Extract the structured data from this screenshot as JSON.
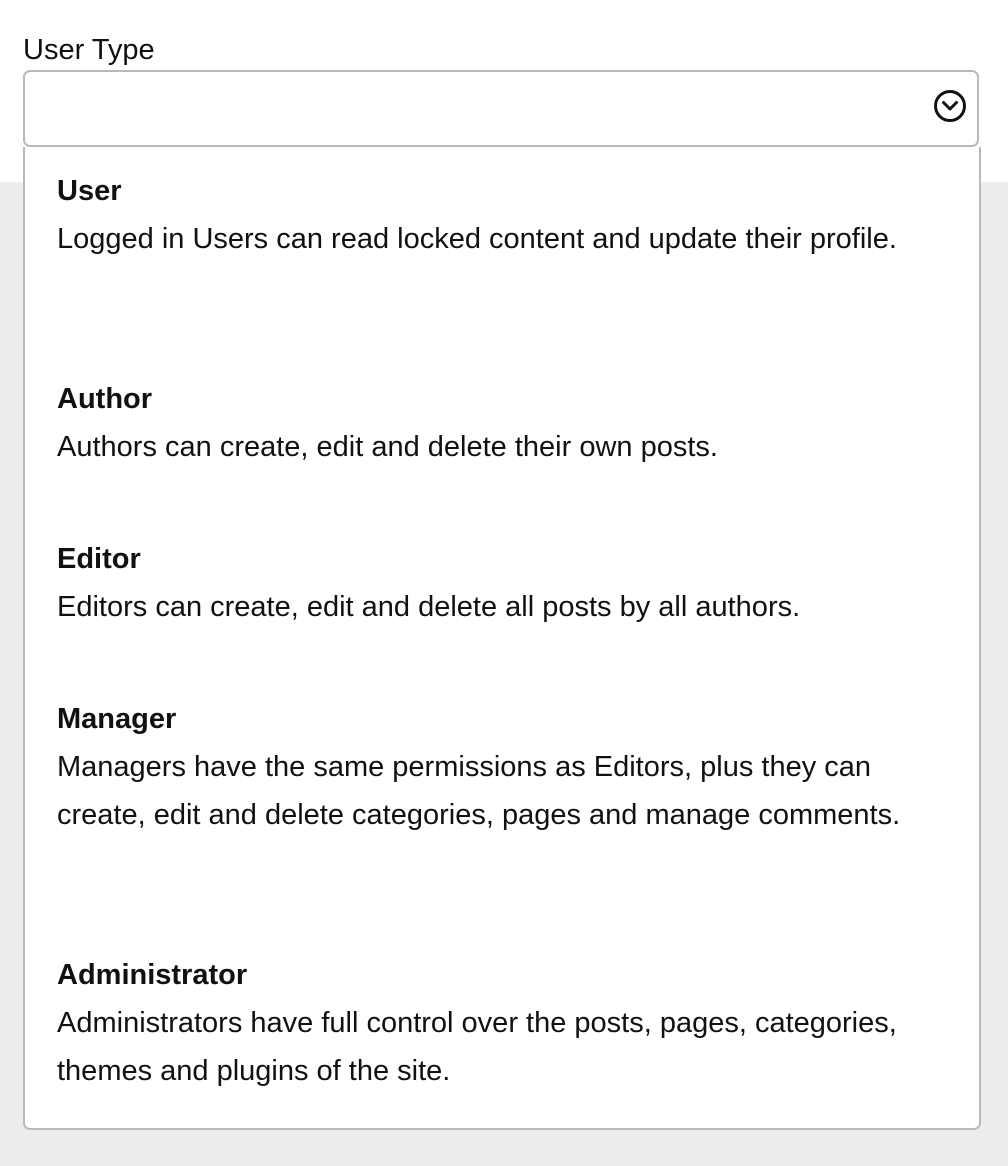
{
  "field": {
    "label": "User Type",
    "selected_value": ""
  },
  "icons": {
    "dropdown": "chevron-down-circle-icon"
  },
  "options": [
    {
      "title": "User",
      "description": "Logged in Users can read locked content and update their profile."
    },
    {
      "title": "Author",
      "description": "Authors can create, edit and delete their own posts."
    },
    {
      "title": "Editor",
      "description": "Editors can create, edit and delete all posts by all authors."
    },
    {
      "title": "Manager",
      "description": "Managers have the same permissions as Editors, plus they can create, edit and delete categories, pages and manage comments."
    },
    {
      "title": "Administrator",
      "description": "Administrators have full control over the posts, pages, categories, themes and plugins of the site."
    }
  ],
  "colors": {
    "border": "#b9b9b9",
    "background": "#ececec",
    "surface": "#ffffff",
    "text": "#111111"
  }
}
